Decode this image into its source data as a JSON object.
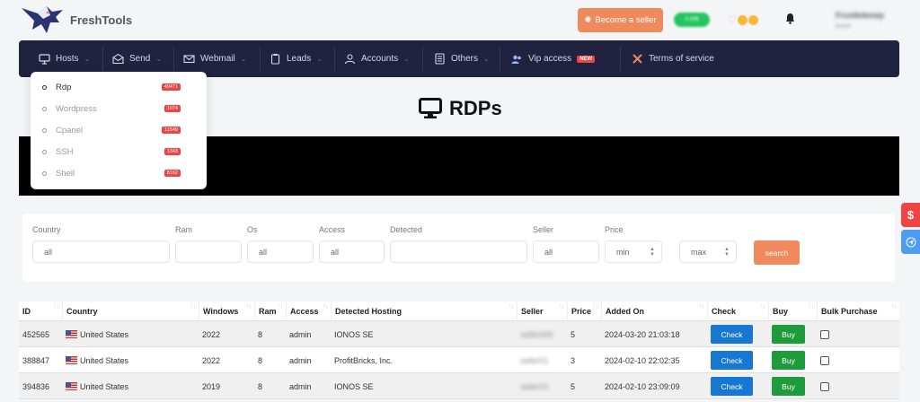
{
  "header": {
    "brand": "FreshTools",
    "become_seller": "Become a seller",
    "balance": "0.00$",
    "user_name": "Frustkdenep",
    "user_sub": "buyer"
  },
  "nav": {
    "items": [
      {
        "label": "Hosts",
        "icon": "monitor-icon"
      },
      {
        "label": "Send",
        "icon": "envelope-open-icon"
      },
      {
        "label": "Webmail",
        "icon": "mail-icon"
      },
      {
        "label": "Leads",
        "icon": "clipboard-icon"
      },
      {
        "label": "Accounts",
        "icon": "user-icon"
      },
      {
        "label": "Others",
        "icon": "document-icon"
      },
      {
        "label": "Vip access",
        "icon": "users-icon",
        "badge": "NEW"
      },
      {
        "label": "Terms of service",
        "icon": "tools-icon"
      }
    ]
  },
  "dropdown": {
    "items": [
      {
        "label": "Rdp",
        "count": "40471",
        "active": true
      },
      {
        "label": "Wordpress",
        "count": "1074"
      },
      {
        "label": "Cpanel",
        "count": "11549"
      },
      {
        "label": "SSH",
        "count": "1343"
      },
      {
        "label": "Shell",
        "count": "8162"
      }
    ]
  },
  "page": {
    "title": "RDPs"
  },
  "filters": {
    "country_label": "Country",
    "country_value": "all",
    "ram_label": "Ram",
    "os_label": "Os",
    "os_value": "all",
    "access_label": "Access",
    "access_value": "all",
    "detected_label": "Detected",
    "seller_label": "Seller",
    "seller_value": "all",
    "price_label": "Price",
    "min_placeholder": "min",
    "max_placeholder": "max",
    "search_label": "search"
  },
  "table": {
    "headers": [
      "ID",
      "Country",
      "Windows",
      "Ram",
      "Access",
      "Detected Hosting",
      "Seller",
      "Price",
      "Added On",
      "Check",
      "Buy",
      "Bulk Purchase"
    ],
    "rows": [
      {
        "id": "452565",
        "country": "United States",
        "windows": "2022",
        "ram": "8",
        "access": "admin",
        "hosting": "IONOS SE",
        "seller": "seller000",
        "price": "5",
        "added": "2024-03-20 21:03:18"
      },
      {
        "id": "388847",
        "country": "United States",
        "windows": "2022",
        "ram": "8",
        "access": "admin",
        "hosting": "ProfitBricks, Inc.",
        "seller": "seller01",
        "price": "3",
        "added": "2024-02-10 22:02:35"
      },
      {
        "id": "394836",
        "country": "United States",
        "windows": "2019",
        "ram": "8",
        "access": "admin",
        "hosting": "IONOS SE",
        "seller": "seller02",
        "price": "5",
        "added": "2024-02-10 23:09:09"
      }
    ],
    "check_label": "Check",
    "buy_label": "Buy"
  },
  "colors": {
    "nav_bg": "#1f2340",
    "accent_orange": "#f08a5d",
    "check_blue": "#1678d2",
    "buy_green": "#1e9b3a",
    "badge_red": "#ef4444"
  }
}
